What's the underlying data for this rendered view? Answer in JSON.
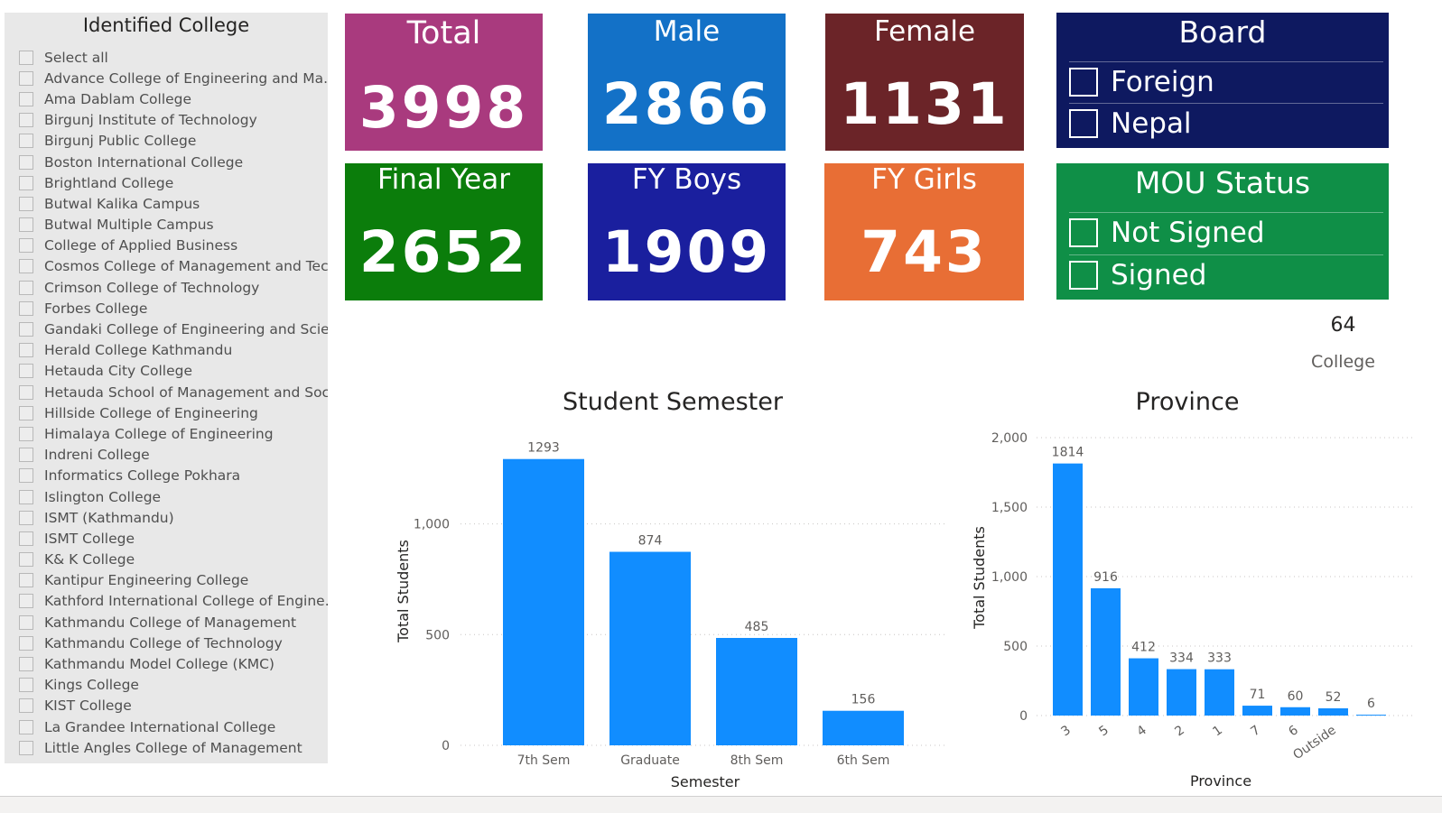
{
  "slicer": {
    "title": "Identified College",
    "items": [
      "Select all",
      "Advance College of Engineering and Ma...",
      "Ama Dablam College",
      "Birgunj Institute of Technology",
      "Birgunj Public College",
      "Boston International College",
      "Brightland College",
      "Butwal Kalika Campus",
      "Butwal Multiple Campus",
      "College of Applied Business",
      "Cosmos College of Management and Tec...",
      "Crimson College of Technology",
      "Forbes College",
      "Gandaki College of Engineering and Scie...",
      "Herald College Kathmandu",
      "Hetauda City College",
      "Hetauda School of Management and Soc...",
      "Hillside College of Engineering",
      "Himalaya College of Engineering",
      "Indreni College",
      "Informatics College Pokhara",
      "Islington College",
      "ISMT (Kathmandu)",
      "ISMT College",
      "K& K College",
      "Kantipur Engineering College",
      "Kathford International College of Engine...",
      "Kathmandu College of Management",
      "Kathmandu College of Technology",
      "Kathmandu Model College (KMC)",
      "Kings College",
      "KIST College",
      "La Grandee International College",
      "Little Angles College of Management"
    ]
  },
  "cards": {
    "total": {
      "label": "Total",
      "value": "3998",
      "color": "#a93a7e"
    },
    "male": {
      "label": "Male",
      "value": "2866",
      "color": "#1371c7"
    },
    "female": {
      "label": "Female",
      "value": "1131",
      "color": "#6b2428"
    },
    "final_year": {
      "label": "Final Year",
      "value": "2652",
      "color": "#0b7d0b"
    },
    "fy_boys": {
      "label": "FY Boys",
      "value": "1909",
      "color": "#1a1f9e"
    },
    "fy_girls": {
      "label": "FY Girls",
      "value": "743",
      "color": "#e86e35"
    }
  },
  "board": {
    "title": "Board",
    "options": [
      "Foreign",
      "Nepal"
    ],
    "color": "#0e1960"
  },
  "mou": {
    "title": "MOU Status",
    "options": [
      "Not Signed",
      "Signed"
    ],
    "color": "#0f8f47"
  },
  "college_kpi": {
    "value": "64",
    "label": "College"
  },
  "chart_data": [
    {
      "type": "bar",
      "title": "Student Semester",
      "xlabel": "Semester",
      "ylabel": "Total Students",
      "categories": [
        "7th Sem",
        "Graduate",
        "8th Sem",
        "6th Sem"
      ],
      "values": [
        1293,
        874,
        485,
        156
      ],
      "ylim": [
        0,
        1300
      ],
      "yticks": [
        "0",
        "500",
        "1,000"
      ],
      "color": "#118dff",
      "grid": true
    },
    {
      "type": "bar",
      "title": "Province",
      "xlabel": "Province",
      "ylabel": "Total Students",
      "categories": [
        "3",
        "5",
        "4",
        "2",
        "1",
        "7",
        "6",
        "Outside"
      ],
      "values": [
        1814,
        916,
        412,
        334,
        333,
        71,
        60,
        52,
        6
      ],
      "ylim": [
        0,
        2000
      ],
      "yticks": [
        "0",
        "500",
        "1,000",
        "1,500",
        "2,000"
      ],
      "color": "#118dff",
      "grid": true
    }
  ]
}
